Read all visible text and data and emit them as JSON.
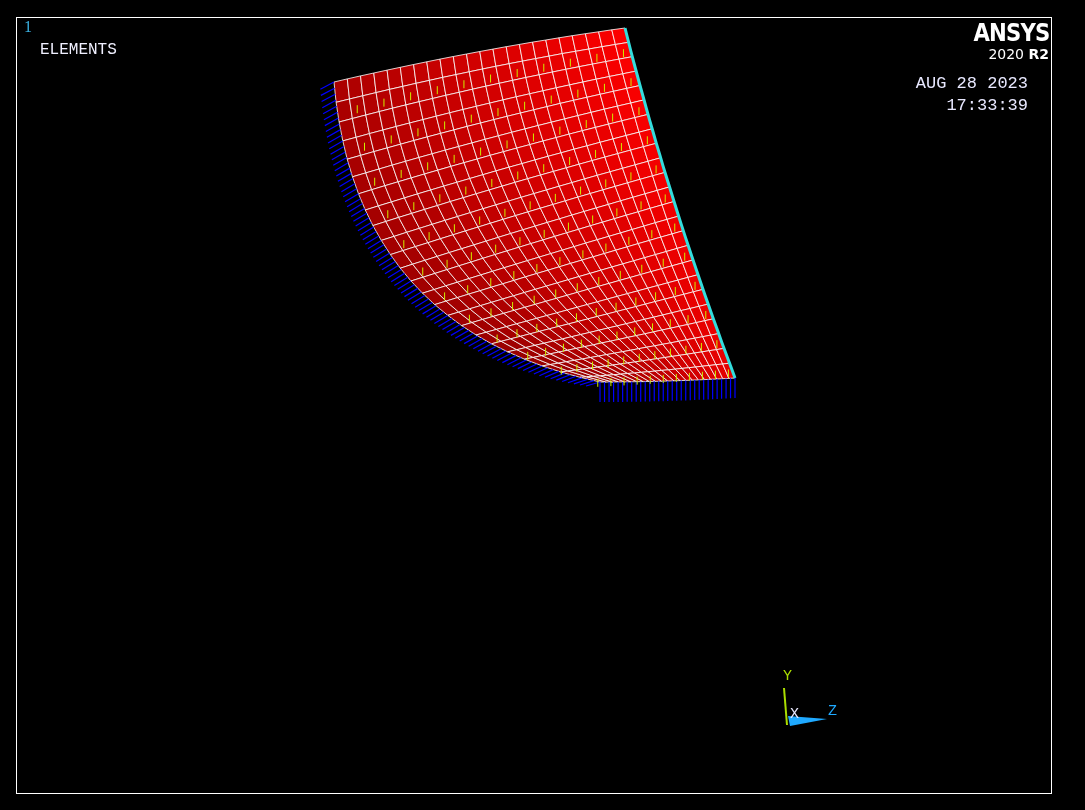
{
  "window": {
    "number": "1",
    "title": "ELEMENTS"
  },
  "logo": {
    "brand": "ANSYS",
    "version": "2020",
    "release": "R2"
  },
  "date": "AUG 28 2023",
  "time": "17:33:39",
  "triad": {
    "y_label": "Y",
    "x_label": "X",
    "z_label": "Z"
  }
}
